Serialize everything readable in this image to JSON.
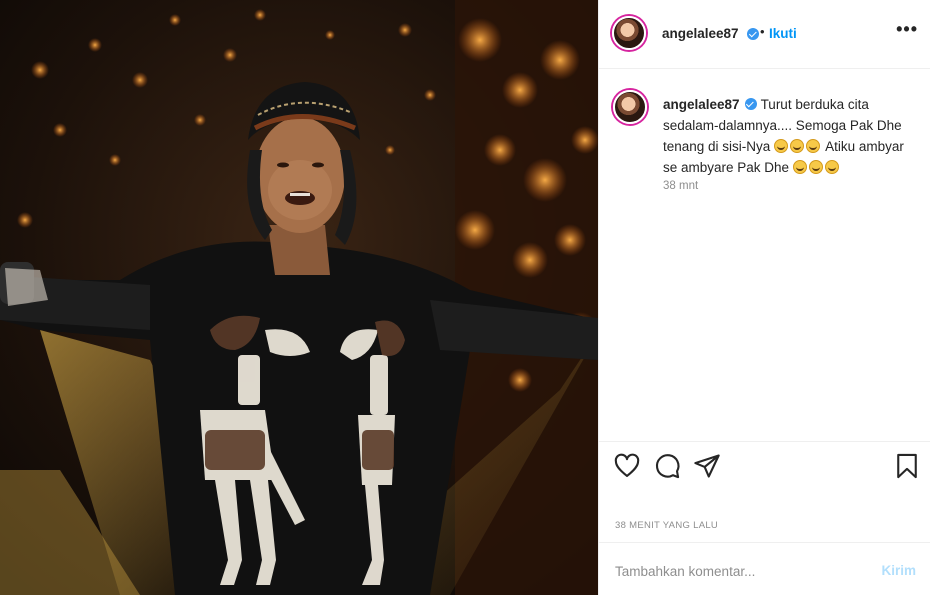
{
  "post": {
    "username": "angelalee87",
    "verified": true,
    "follow_separator": "•",
    "follow_label": "Ikuti",
    "more_icon": "more-options-icon",
    "more_label": "•••"
  },
  "caption": {
    "username": "angelalee87",
    "text_part1": "Turut berduka cita sedalam-dalamnya.... Semoga Pak Dhe tenang di sisi-Nya",
    "text_part2": "Atiku ambyar se ambyare Pak Dhe",
    "emoji_name": "loudly-crying-face",
    "time": "38 mnt"
  },
  "actions": {
    "like_icon": "heart-icon",
    "comment_icon": "comment-icon",
    "share_icon": "share-icon",
    "save_icon": "bookmark-icon"
  },
  "posted_time": "38 MENIT YANG LALU",
  "comment": {
    "placeholder": "Tambahkan komentar...",
    "send_label": "Kirim"
  },
  "colors": {
    "link": "#0095f6",
    "verified": "#3897f0",
    "muted": "#8e8e8e",
    "send_disabled": "#b2dffc"
  }
}
